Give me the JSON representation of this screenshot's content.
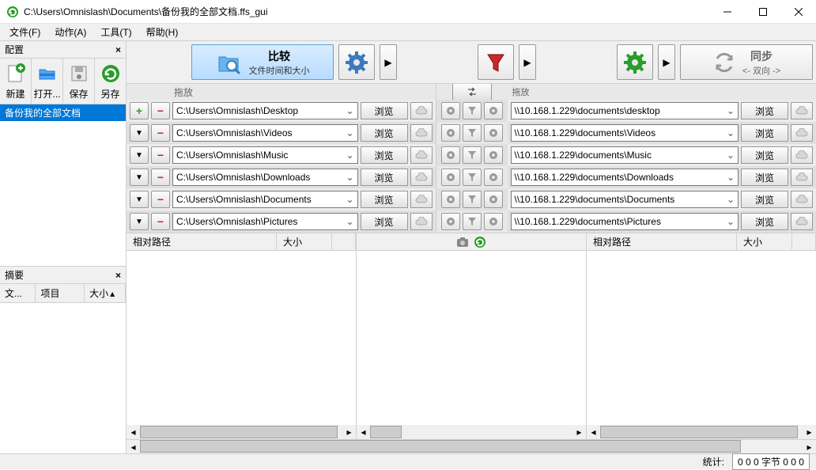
{
  "titlebar": {
    "title": "C:\\Users\\Omnislash\\Documents\\备份我的全部文档.ffs_gui"
  },
  "menu": {
    "file": "文件(F)",
    "action": "动作(A)",
    "tools": "工具(T)",
    "help": "帮助(H)"
  },
  "sidebar": {
    "config_title": "配置",
    "tools": {
      "new": "新建",
      "open": "打开...",
      "save": "保存",
      "saveas": "另存"
    },
    "config_list": {
      "item0": "备份我的全部文档"
    },
    "summary_title": "摘要",
    "summary_cols": {
      "file": "文...",
      "item": "项目",
      "size": "大小"
    }
  },
  "toolbar": {
    "compare": {
      "main": "比较",
      "sub": "文件时间和大小"
    },
    "sync": {
      "main": "同步",
      "sub": "<- 双向 ->"
    }
  },
  "folders": {
    "drag_label": "拖放",
    "browse": "浏览",
    "left": [
      "C:\\Users\\Omnislash\\Desktop",
      "C:\\Users\\Omnislash\\Videos",
      "C:\\Users\\Omnislash\\Music",
      "C:\\Users\\Omnislash\\Downloads",
      "C:\\Users\\Omnislash\\Documents",
      "C:\\Users\\Omnislash\\Pictures"
    ],
    "right": [
      "\\\\10.168.1.229\\documents\\desktop",
      "\\\\10.168.1.229\\documents\\Videos",
      "\\\\10.168.1.229\\documents\\Music",
      "\\\\10.168.1.229\\documents\\Downloads",
      "\\\\10.168.1.229\\documents\\Documents",
      "\\\\10.168.1.229\\documents\\Pictures"
    ]
  },
  "list": {
    "col_path": "相对路径",
    "col_size": "大小"
  },
  "status": {
    "label": "统计:",
    "value": "0   0   0 字节   0   0   0"
  }
}
